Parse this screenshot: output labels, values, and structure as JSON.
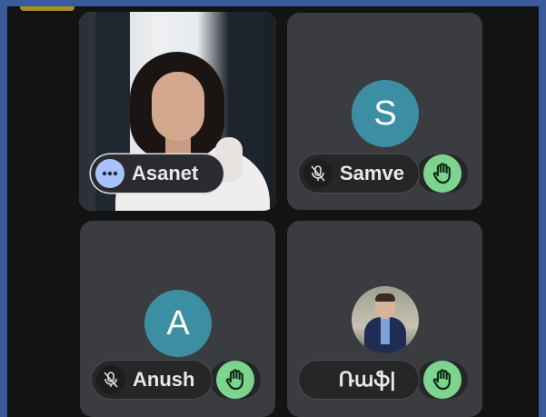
{
  "participants": [
    {
      "name": "Asanet",
      "avatar_letter": "",
      "mic": "more-options",
      "hand_raised": false,
      "video_on": true
    },
    {
      "name": "Samve",
      "avatar_letter": "S",
      "mic": "muted",
      "hand_raised": true,
      "video_on": false
    },
    {
      "name": "Anush",
      "avatar_letter": "A",
      "mic": "muted",
      "hand_raised": true,
      "video_on": false
    },
    {
      "name": "Ռաֆ|",
      "avatar_letter": "",
      "mic": "none",
      "hand_raised": true,
      "video_on": false
    }
  ],
  "colors": {
    "avatar_bg": "#3c8fa3",
    "raise_hand_bg": "#7dd48f",
    "more_btn_bg": "#a8c3f7",
    "tile_bg": "#3b3c3f",
    "stage_bg": "#131313"
  },
  "icons": {
    "more": "more-horizontal-icon",
    "mic_off": "mic-off-icon",
    "hand": "raised-hand-icon"
  }
}
